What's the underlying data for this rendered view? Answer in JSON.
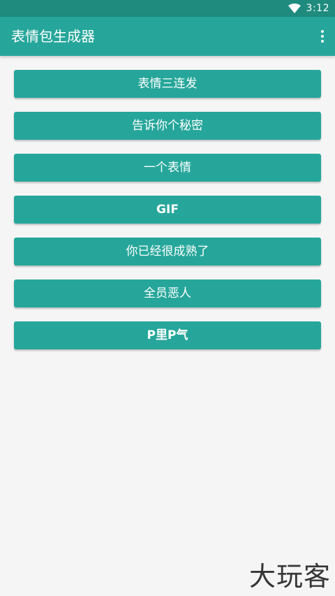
{
  "status_bar": {
    "time": "3:12",
    "wifi_icon": "wifi-icon"
  },
  "app_bar": {
    "title": "表情包生成器",
    "overflow_icon": "more-vert-icon",
    "background": "#26a69a"
  },
  "buttons": [
    {
      "label": "表情三连发"
    },
    {
      "label": "告诉你个秘密"
    },
    {
      "label": "一个表情"
    },
    {
      "label": "GIF"
    },
    {
      "label": "你已经很成熟了"
    },
    {
      "label": "全员恶人"
    },
    {
      "label": "P里P气"
    }
  ],
  "watermark": "大玩客",
  "colors": {
    "status_bar": "#1e8b7e",
    "accent": "#26a69a",
    "background": "#f5f5f5"
  }
}
